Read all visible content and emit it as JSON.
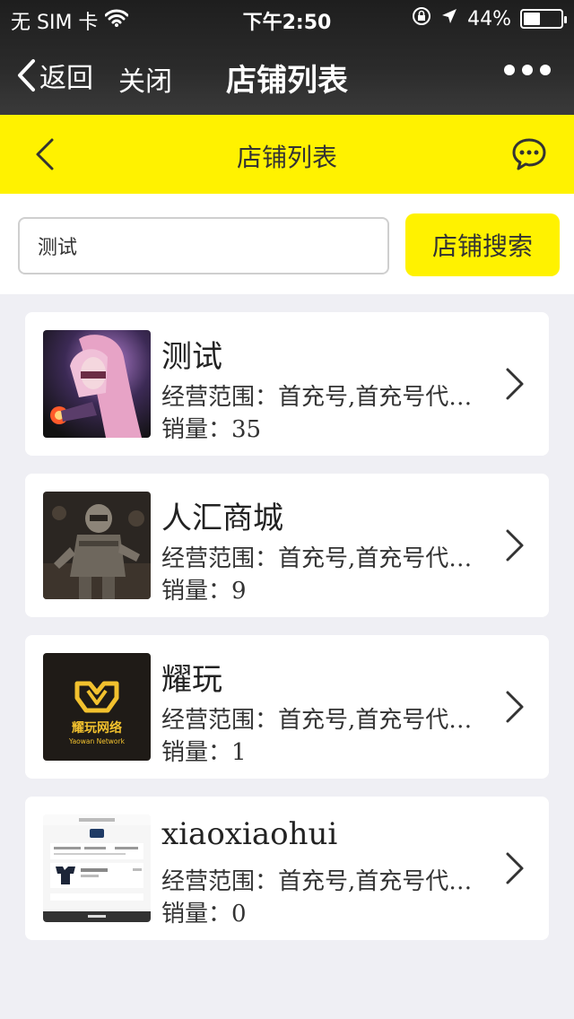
{
  "status_bar": {
    "carrier": "无 SIM 卡",
    "time": "下午2:50",
    "battery": "44%",
    "battery_level": 0.44
  },
  "navbar": {
    "back_label": "返回",
    "close_label": "关闭",
    "title": "店铺列表"
  },
  "page_header": {
    "title": "店铺列表"
  },
  "search": {
    "value": "测试",
    "button_label": "店铺搜索"
  },
  "shops": [
    {
      "name": "测试",
      "scope": "经营范围：首充号,首充号代充,游戏币",
      "sales": "销量：35",
      "thumb": "anime-girl-avatar"
    },
    {
      "name": "人汇商城",
      "scope": "经营范围：首充号,首充号代充,游戏币",
      "sales": "销量：9",
      "thumb": "armored-soldier-avatar"
    },
    {
      "name": "耀玩",
      "scope": "经营范围：首充号,首充号代充,游戏币",
      "sales": "销量：1",
      "thumb": "yaowan-logo"
    },
    {
      "name": "xiaoxiaohui",
      "scope": "经营范围：首充号,首充号代充,游戏币",
      "sales": "销量：0",
      "thumb": "order-screenshot"
    }
  ],
  "logo_text": {
    "brand_cn": "耀玩网络",
    "brand_en": "Yaowan Network"
  },
  "colors": {
    "accent_yellow": "#fff200",
    "header_dark": "#2b2b2b",
    "page_bg": "#efeff4"
  }
}
